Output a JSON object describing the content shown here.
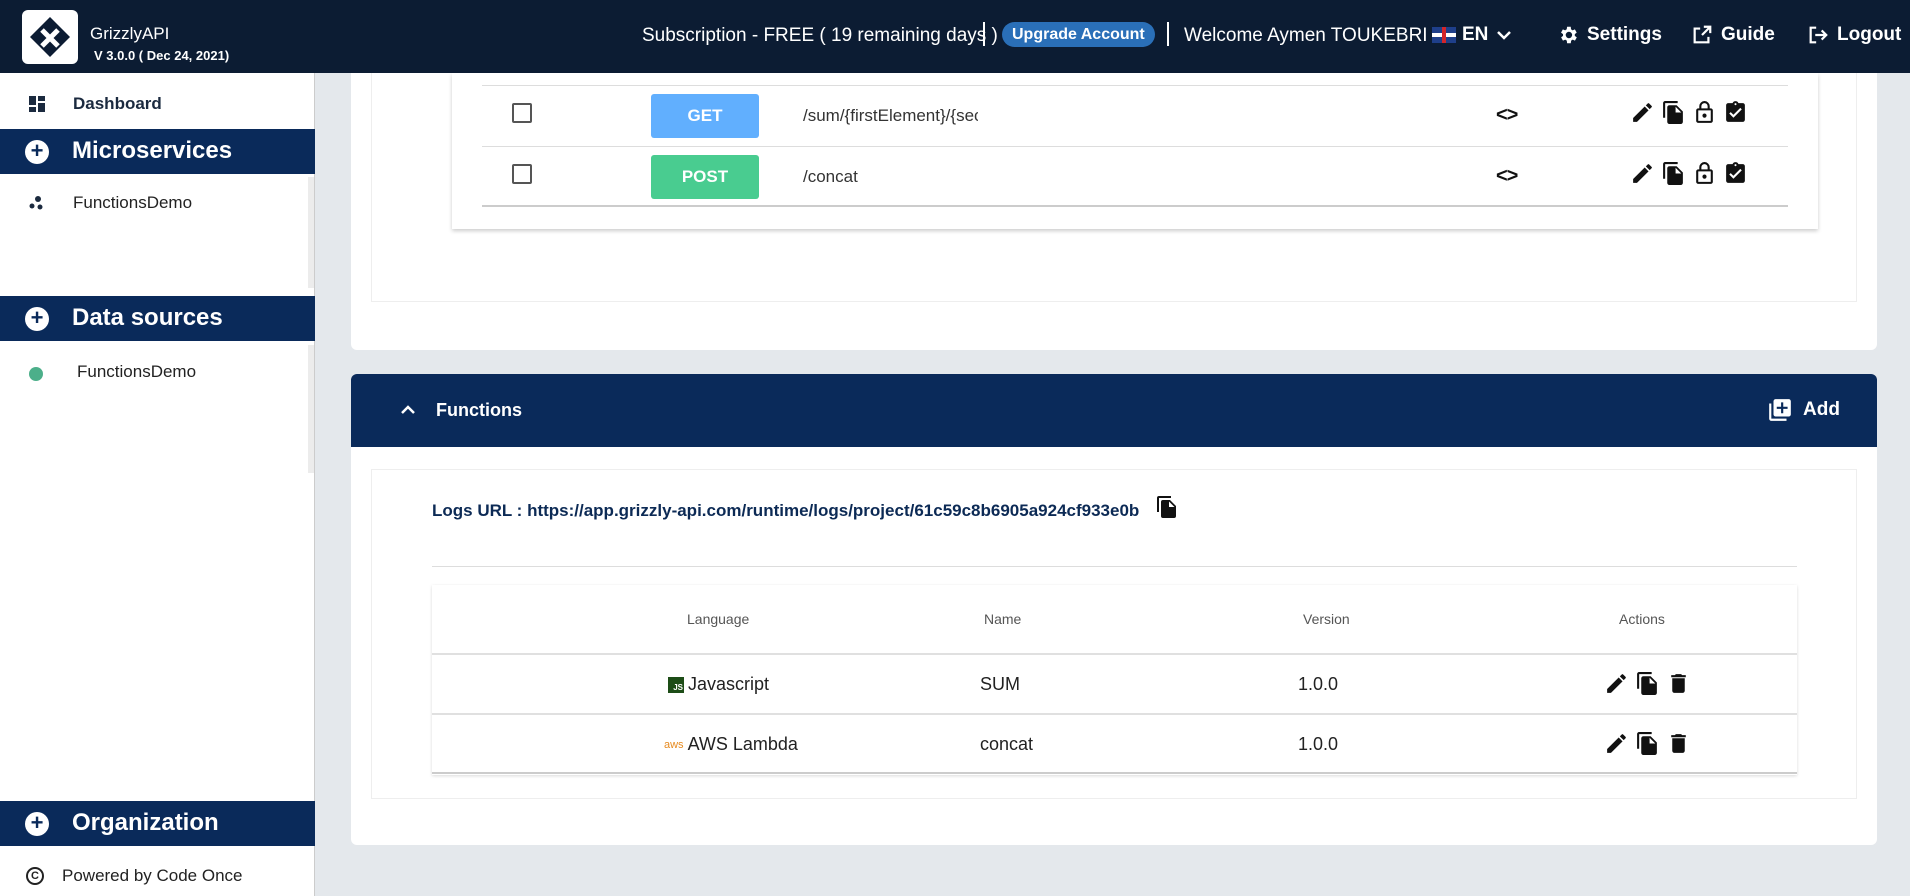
{
  "header": {
    "app_name": "GrizzlyAPI",
    "version": "V 3.0.0 ( Dec 24, 2021)",
    "subscription": "Subscription  - FREE ( 19 remaining days )",
    "upgrade_label": "Upgrade Account",
    "welcome": "Welcome  Aymen   TOUKEBRI",
    "language": "EN",
    "settings_label": "Settings",
    "guide_label": "Guide",
    "logout_label": "Logout"
  },
  "sidebar": {
    "dashboard_label": "Dashboard",
    "microservices_label": "Microservices",
    "microservice_items": [
      "FunctionsDemo"
    ],
    "datasources_label": "Data sources",
    "datasource_items": [
      "FunctionsDemo"
    ],
    "organization_label": "Organization",
    "powered_by": "Powered by Code Once"
  },
  "endpoints": [
    {
      "method": "GET",
      "path": "/sum/{firstElement}/{secondElement}"
    },
    {
      "method": "POST",
      "path": "/concat"
    }
  ],
  "functions": {
    "title": "Functions",
    "add_label": "Add",
    "logs_url": "Logs URL : https://app.grizzly-api.com/runtime/logs/project/61c59c8b6905a924cf933e0b",
    "columns": {
      "language": "Language",
      "name": "Name",
      "version": "Version",
      "actions": "Actions"
    },
    "rows": [
      {
        "language": "Javascript",
        "badge": "JS",
        "name": "SUM",
        "version": "1.0.0"
      },
      {
        "language": "AWS Lambda",
        "badge": "aws",
        "name": "concat",
        "version": "1.0.0"
      }
    ]
  },
  "colors": {
    "topbar": "#0c1c33",
    "navy": "#0a2a5a",
    "get": "#61affe",
    "post": "#49cc90",
    "upgrade": "#2a6fb8"
  }
}
